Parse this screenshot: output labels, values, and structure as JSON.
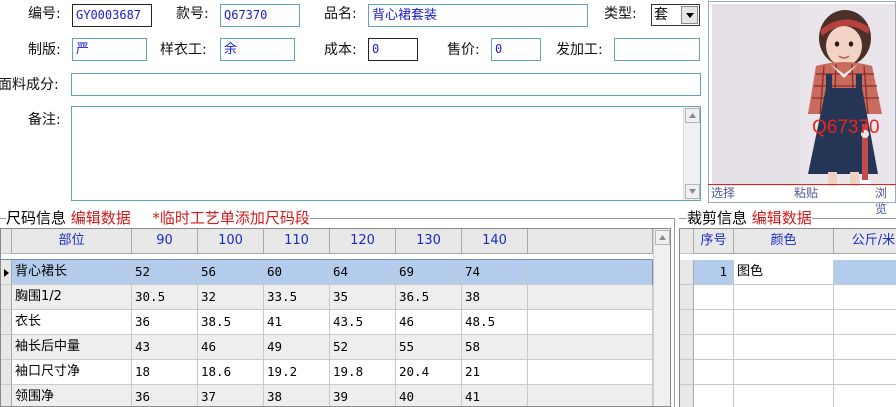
{
  "form": {
    "labels": {
      "code": "编号:",
      "style_no": "款号:",
      "product_name": "品名:",
      "type": "类型:",
      "pattern": "制版:",
      "sample_worker": "样衣工:",
      "cost": "成本:",
      "price": "售价:",
      "outsource": "发加工:",
      "fabric": "面料成分:",
      "notes": "备注:"
    },
    "values": {
      "code": "GY0003687",
      "style_no": "Q67370",
      "product_name": "背心裙套装",
      "type": "套",
      "pattern": "严",
      "sample_worker": "余",
      "cost": "0",
      "price": "0",
      "outsource": "",
      "fabric": "",
      "notes": ""
    }
  },
  "photo": {
    "overlay_text": "Q67370",
    "actions": {
      "select": "选择",
      "paste": "粘贴",
      "browse": "浏览"
    }
  },
  "size_section": {
    "title": "尺码信息",
    "edit_link": "编辑数据",
    "temp_link": "*临时工艺单添加尺码段",
    "columns": [
      "部位",
      "90",
      "100",
      "110",
      "120",
      "130",
      "140"
    ],
    "rows": [
      [
        "背心裙长",
        "52",
        "56",
        "60",
        "64",
        "69",
        "74"
      ],
      [
        "胸围1/2",
        "30.5",
        "32",
        "33.5",
        "35",
        "36.5",
        "38"
      ],
      [
        "衣长",
        "36",
        "38.5",
        "41",
        "43.5",
        "46",
        "48.5"
      ],
      [
        "袖长后中量",
        "43",
        "46",
        "49",
        "52",
        "55",
        "58"
      ],
      [
        "袖口尺寸净",
        "18",
        "18.6",
        "19.2",
        "19.8",
        "20.4",
        "21"
      ],
      [
        "领围净",
        "36",
        "37",
        "38",
        "39",
        "40",
        "41"
      ]
    ]
  },
  "cut_section": {
    "title": "裁剪信息",
    "edit_link": "编辑数据",
    "columns": [
      "序号",
      "颜色",
      "公斤/米"
    ],
    "rows": [
      [
        "1",
        "图色",
        ""
      ]
    ]
  },
  "colors": {
    "field_border": "#5fa3bf",
    "value_text": "#1a1ad0",
    "header_text": "#1c2ac4",
    "link_red": "#d41a1a",
    "selected_row": "#b4ccec"
  }
}
